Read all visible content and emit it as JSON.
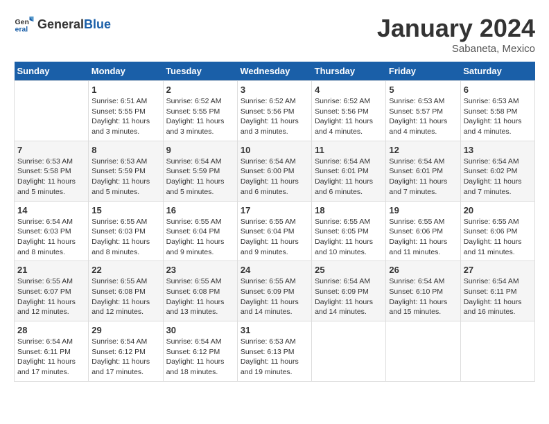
{
  "header": {
    "logo_general": "General",
    "logo_blue": "Blue",
    "month_title": "January 2024",
    "subtitle": "Sabaneta, Mexico"
  },
  "days_of_week": [
    "Sunday",
    "Monday",
    "Tuesday",
    "Wednesday",
    "Thursday",
    "Friday",
    "Saturday"
  ],
  "weeks": [
    [
      {
        "day": "",
        "sunrise": "",
        "sunset": "",
        "daylight": ""
      },
      {
        "day": "1",
        "sunrise": "Sunrise: 6:51 AM",
        "sunset": "Sunset: 5:55 PM",
        "daylight": "Daylight: 11 hours and 3 minutes."
      },
      {
        "day": "2",
        "sunrise": "Sunrise: 6:52 AM",
        "sunset": "Sunset: 5:55 PM",
        "daylight": "Daylight: 11 hours and 3 minutes."
      },
      {
        "day": "3",
        "sunrise": "Sunrise: 6:52 AM",
        "sunset": "Sunset: 5:56 PM",
        "daylight": "Daylight: 11 hours and 3 minutes."
      },
      {
        "day": "4",
        "sunrise": "Sunrise: 6:52 AM",
        "sunset": "Sunset: 5:56 PM",
        "daylight": "Daylight: 11 hours and 4 minutes."
      },
      {
        "day": "5",
        "sunrise": "Sunrise: 6:53 AM",
        "sunset": "Sunset: 5:57 PM",
        "daylight": "Daylight: 11 hours and 4 minutes."
      },
      {
        "day": "6",
        "sunrise": "Sunrise: 6:53 AM",
        "sunset": "Sunset: 5:58 PM",
        "daylight": "Daylight: 11 hours and 4 minutes."
      }
    ],
    [
      {
        "day": "7",
        "sunrise": "Sunrise: 6:53 AM",
        "sunset": "Sunset: 5:58 PM",
        "daylight": "Daylight: 11 hours and 5 minutes."
      },
      {
        "day": "8",
        "sunrise": "Sunrise: 6:53 AM",
        "sunset": "Sunset: 5:59 PM",
        "daylight": "Daylight: 11 hours and 5 minutes."
      },
      {
        "day": "9",
        "sunrise": "Sunrise: 6:54 AM",
        "sunset": "Sunset: 5:59 PM",
        "daylight": "Daylight: 11 hours and 5 minutes."
      },
      {
        "day": "10",
        "sunrise": "Sunrise: 6:54 AM",
        "sunset": "Sunset: 6:00 PM",
        "daylight": "Daylight: 11 hours and 6 minutes."
      },
      {
        "day": "11",
        "sunrise": "Sunrise: 6:54 AM",
        "sunset": "Sunset: 6:01 PM",
        "daylight": "Daylight: 11 hours and 6 minutes."
      },
      {
        "day": "12",
        "sunrise": "Sunrise: 6:54 AM",
        "sunset": "Sunset: 6:01 PM",
        "daylight": "Daylight: 11 hours and 7 minutes."
      },
      {
        "day": "13",
        "sunrise": "Sunrise: 6:54 AM",
        "sunset": "Sunset: 6:02 PM",
        "daylight": "Daylight: 11 hours and 7 minutes."
      }
    ],
    [
      {
        "day": "14",
        "sunrise": "Sunrise: 6:54 AM",
        "sunset": "Sunset: 6:03 PM",
        "daylight": "Daylight: 11 hours and 8 minutes."
      },
      {
        "day": "15",
        "sunrise": "Sunrise: 6:55 AM",
        "sunset": "Sunset: 6:03 PM",
        "daylight": "Daylight: 11 hours and 8 minutes."
      },
      {
        "day": "16",
        "sunrise": "Sunrise: 6:55 AM",
        "sunset": "Sunset: 6:04 PM",
        "daylight": "Daylight: 11 hours and 9 minutes."
      },
      {
        "day": "17",
        "sunrise": "Sunrise: 6:55 AM",
        "sunset": "Sunset: 6:04 PM",
        "daylight": "Daylight: 11 hours and 9 minutes."
      },
      {
        "day": "18",
        "sunrise": "Sunrise: 6:55 AM",
        "sunset": "Sunset: 6:05 PM",
        "daylight": "Daylight: 11 hours and 10 minutes."
      },
      {
        "day": "19",
        "sunrise": "Sunrise: 6:55 AM",
        "sunset": "Sunset: 6:06 PM",
        "daylight": "Daylight: 11 hours and 11 minutes."
      },
      {
        "day": "20",
        "sunrise": "Sunrise: 6:55 AM",
        "sunset": "Sunset: 6:06 PM",
        "daylight": "Daylight: 11 hours and 11 minutes."
      }
    ],
    [
      {
        "day": "21",
        "sunrise": "Sunrise: 6:55 AM",
        "sunset": "Sunset: 6:07 PM",
        "daylight": "Daylight: 11 hours and 12 minutes."
      },
      {
        "day": "22",
        "sunrise": "Sunrise: 6:55 AM",
        "sunset": "Sunset: 6:08 PM",
        "daylight": "Daylight: 11 hours and 12 minutes."
      },
      {
        "day": "23",
        "sunrise": "Sunrise: 6:55 AM",
        "sunset": "Sunset: 6:08 PM",
        "daylight": "Daylight: 11 hours and 13 minutes."
      },
      {
        "day": "24",
        "sunrise": "Sunrise: 6:55 AM",
        "sunset": "Sunset: 6:09 PM",
        "daylight": "Daylight: 11 hours and 14 minutes."
      },
      {
        "day": "25",
        "sunrise": "Sunrise: 6:54 AM",
        "sunset": "Sunset: 6:09 PM",
        "daylight": "Daylight: 11 hours and 14 minutes."
      },
      {
        "day": "26",
        "sunrise": "Sunrise: 6:54 AM",
        "sunset": "Sunset: 6:10 PM",
        "daylight": "Daylight: 11 hours and 15 minutes."
      },
      {
        "day": "27",
        "sunrise": "Sunrise: 6:54 AM",
        "sunset": "Sunset: 6:11 PM",
        "daylight": "Daylight: 11 hours and 16 minutes."
      }
    ],
    [
      {
        "day": "28",
        "sunrise": "Sunrise: 6:54 AM",
        "sunset": "Sunset: 6:11 PM",
        "daylight": "Daylight: 11 hours and 17 minutes."
      },
      {
        "day": "29",
        "sunrise": "Sunrise: 6:54 AM",
        "sunset": "Sunset: 6:12 PM",
        "daylight": "Daylight: 11 hours and 17 minutes."
      },
      {
        "day": "30",
        "sunrise": "Sunrise: 6:54 AM",
        "sunset": "Sunset: 6:12 PM",
        "daylight": "Daylight: 11 hours and 18 minutes."
      },
      {
        "day": "31",
        "sunrise": "Sunrise: 6:53 AM",
        "sunset": "Sunset: 6:13 PM",
        "daylight": "Daylight: 11 hours and 19 minutes."
      },
      {
        "day": "",
        "sunrise": "",
        "sunset": "",
        "daylight": ""
      },
      {
        "day": "",
        "sunrise": "",
        "sunset": "",
        "daylight": ""
      },
      {
        "day": "",
        "sunrise": "",
        "sunset": "",
        "daylight": ""
      }
    ]
  ]
}
